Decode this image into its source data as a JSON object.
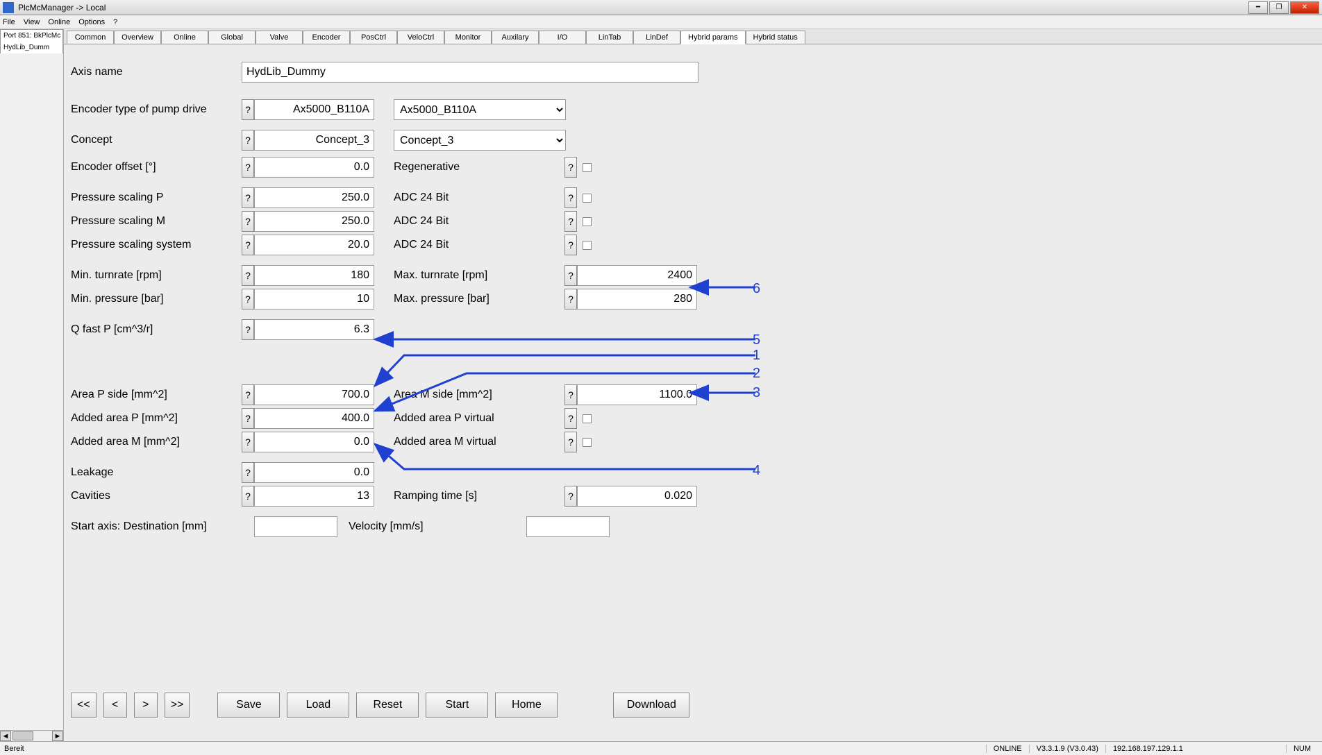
{
  "window": {
    "title": "PlcMcManager -> Local",
    "menus": [
      "File",
      "View",
      "Online",
      "Options",
      "?"
    ]
  },
  "sidebar": {
    "line1": "Port 851: BkPlcMc",
    "line2": "HydLib_Dumm"
  },
  "tabs": [
    "Common",
    "Overview",
    "Online",
    "Global",
    "Valve",
    "Encoder",
    "PosCtrl",
    "VeloCtrl",
    "Monitor",
    "Auxilary",
    "I/O",
    "LinTab",
    "LinDef",
    "Hybrid params",
    "Hybrid status"
  ],
  "active_tab": "Hybrid params",
  "labels": {
    "axis_name": "Axis name",
    "encoder_type": "Encoder type of pump drive",
    "concept": "Concept",
    "encoder_offset": "Encoder offset [°]",
    "pressure_scaling_p": "Pressure scaling P",
    "pressure_scaling_m": "Pressure scaling M",
    "pressure_scaling_system": "Pressure scaling system",
    "min_turnrate": "Min. turnrate [rpm]",
    "min_pressure": "Min. pressure [bar]",
    "q_fast_p": "Q fast P [cm^3/r]",
    "area_p_side": "Area P side [mm^2]",
    "added_area_p": "Added area P [mm^2]",
    "added_area_m": "Added area M [mm^2]",
    "leakage": "Leakage",
    "cavities": "Cavities",
    "start_axis": "Start axis: Destination [mm]",
    "regenerative": "Regenerative",
    "adc24": "ADC 24 Bit",
    "max_turnrate": "Max. turnrate [rpm]",
    "max_pressure": "Max. pressure [bar]",
    "area_m_side": "Area M side [mm^2]",
    "added_area_p_virtual": "Added area P virtual",
    "added_area_m_virtual": "Added area M virtual",
    "ramping_time": "Ramping time [s]",
    "velocity": "Velocity [mm/s]",
    "help": "?"
  },
  "values": {
    "axis_name": "HydLib_Dummy",
    "encoder_type": "Ax5000_B110A",
    "encoder_type_sel": "Ax5000_B110A",
    "concept": "Concept_3",
    "concept_sel": "Concept_3",
    "encoder_offset": "0.0",
    "pressure_scaling_p": "250.0",
    "pressure_scaling_m": "250.0",
    "pressure_scaling_system": "20.0",
    "min_turnrate": "180",
    "min_pressure": "10",
    "q_fast_p": "6.3",
    "area_p_side": "700.0",
    "added_area_p": "400.0",
    "added_area_m": "0.0",
    "leakage": "0.0",
    "cavities": "13",
    "max_turnrate": "2400",
    "max_pressure": "280",
    "area_m_side": "1100.0",
    "ramping_time": "0.020",
    "start_axis": "",
    "velocity": ""
  },
  "buttons": {
    "first": "<<",
    "prev": "<",
    "next": ">",
    "last": ">>",
    "save": "Save",
    "load": "Load",
    "reset": "Reset",
    "start": "Start",
    "home": "Home",
    "download": "Download"
  },
  "annotations": {
    "n1": "1",
    "n2": "2",
    "n3": "3",
    "n4": "4",
    "n5": "5",
    "n6": "6"
  },
  "status": {
    "ready": "Bereit",
    "online": "ONLINE",
    "version": "V3.3.1.9 (V3.0.43)",
    "ip": "192.168.197.129.1.1",
    "num": "NUM"
  },
  "chart_data": null
}
